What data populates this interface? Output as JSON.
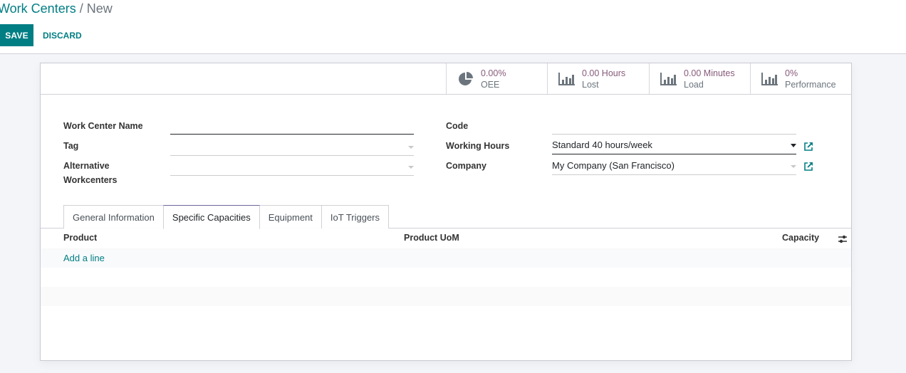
{
  "breadcrumb": {
    "parent": "Work Centers",
    "separator": " / ",
    "current": "New"
  },
  "toolbar": {
    "save_label": "SAVE",
    "discard_label": "DISCARD"
  },
  "stats": [
    {
      "icon": "pie-chart-icon",
      "value": "0.00%",
      "label": "OEE"
    },
    {
      "icon": "bar-chart-icon",
      "value": "0.00 Hours",
      "label": "Lost"
    },
    {
      "icon": "bar-chart-icon",
      "value": "0.00 Minutes",
      "label": "Load"
    },
    {
      "icon": "bar-chart-icon",
      "value": "0%",
      "label": "Performance"
    }
  ],
  "form": {
    "left": {
      "work_center_name": {
        "label": "Work Center Name",
        "value": ""
      },
      "tag": {
        "label": "Tag",
        "value": ""
      },
      "alternative_workcenters": {
        "label_line1": "Alternative",
        "label_line2": "Workcenters",
        "value": ""
      }
    },
    "right": {
      "code": {
        "label": "Code",
        "value": ""
      },
      "working_hours": {
        "label": "Working Hours",
        "value": "Standard 40 hours/week"
      },
      "company": {
        "label": "Company",
        "value": "My Company (San Francisco)"
      }
    }
  },
  "tabs": [
    {
      "label": "General Information",
      "active": false
    },
    {
      "label": "Specific Capacities",
      "active": true
    },
    {
      "label": "Equipment",
      "active": false
    },
    {
      "label": "IoT Triggers",
      "active": false
    }
  ],
  "table": {
    "columns": [
      "Product",
      "Product UoM",
      "Capacity"
    ],
    "add_line_label": "Add a line",
    "rows": []
  },
  "colors": {
    "primary": "#017e84",
    "stat_value": "#875a7b",
    "tab_active_border": "#71639e"
  }
}
